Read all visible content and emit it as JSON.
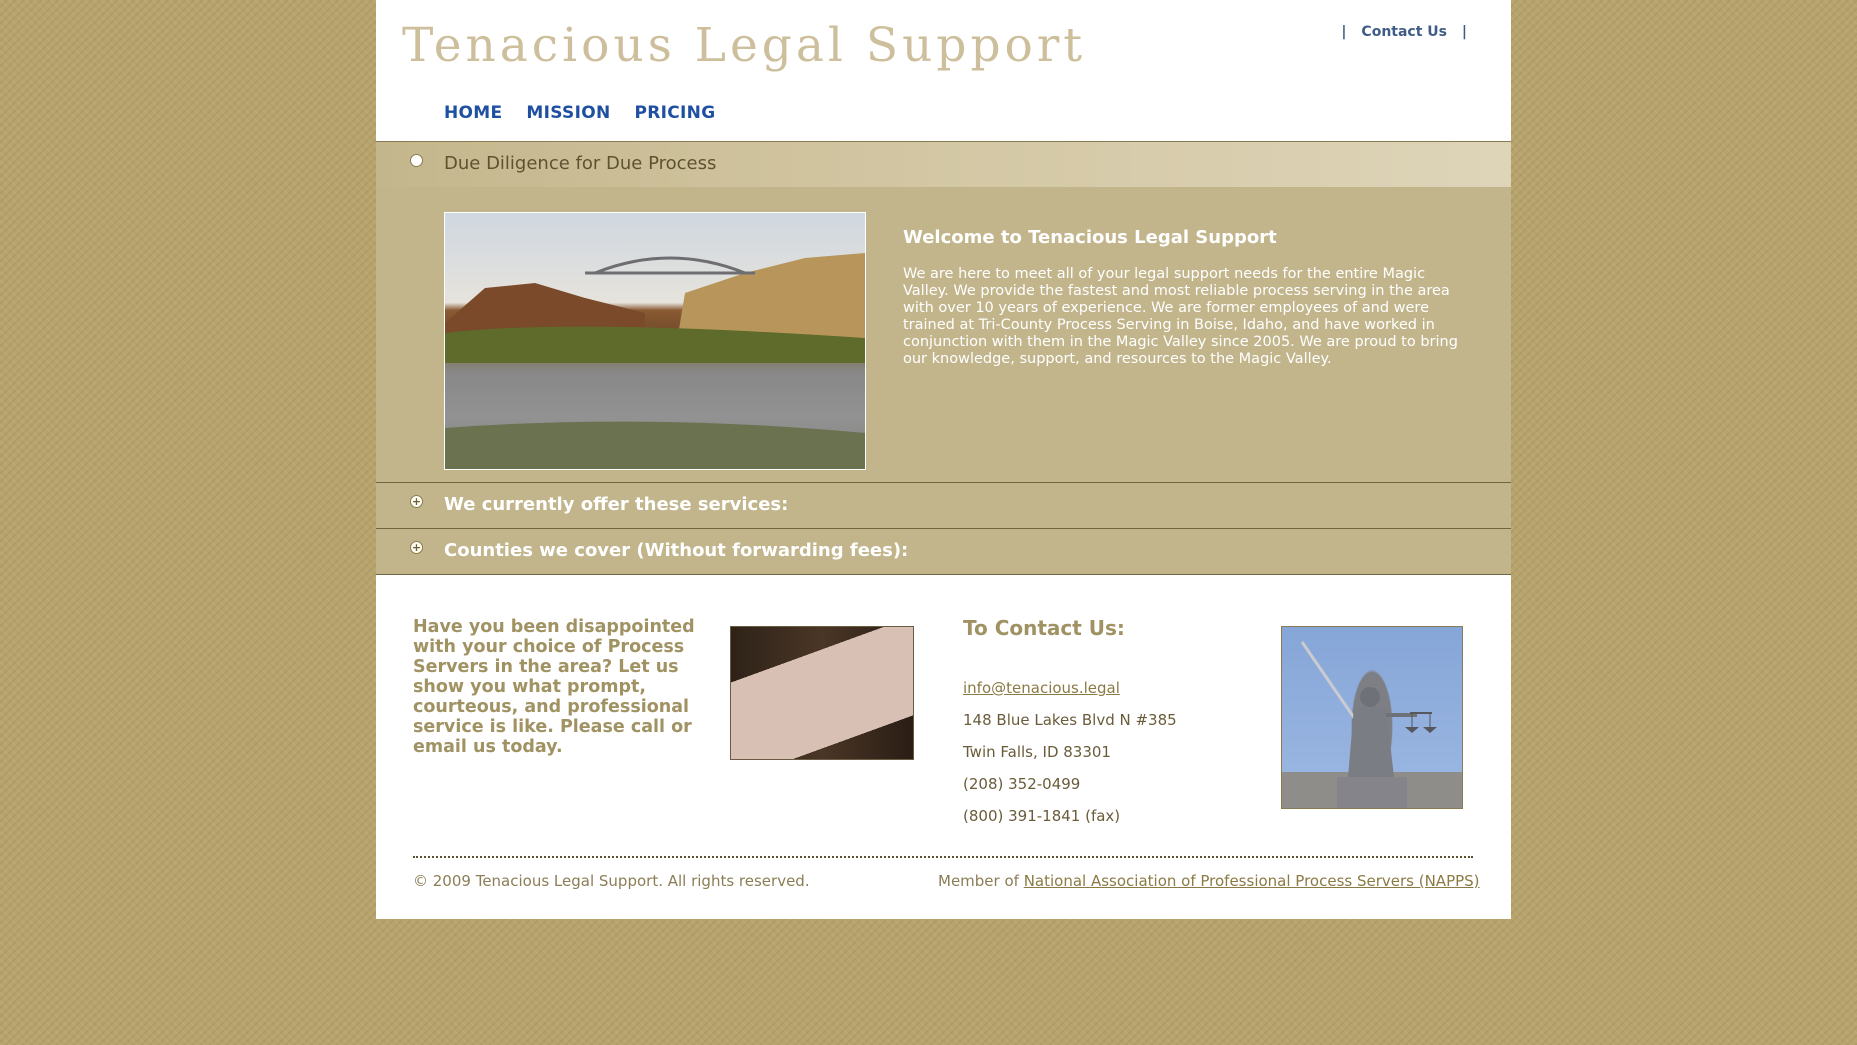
{
  "header": {
    "logo": "Tenacious Legal Support",
    "contact_link": "Contact Us",
    "separator": "|"
  },
  "nav": [
    "HOME",
    "MISSION",
    "PRICING"
  ],
  "banner": {
    "title": "Due Diligence for Due Process"
  },
  "welcome": {
    "title": "Welcome to Tenacious Legal Support",
    "text": "We are here to meet all of your legal support needs for the entire Magic Valley. We provide the fastest and most reliable process serving in the area with over 10 years of experience. We are former employees of and were trained at Tri-County Process Serving in Boise, Idaho, and have worked in conjunction with them in the Magic Valley since 2005. We are proud to bring our knowledge, support, and resources to the Magic Valley."
  },
  "accordion": [
    {
      "label": "We currently offer these services:"
    },
    {
      "label": "Counties we cover (Without forwarding fees):"
    }
  ],
  "promo": "Have you been disappointed with your choice of Process Servers in the area? Let us show you what prompt, courteous, and professional service is like.  Please call or email us today.",
  "contact": {
    "title": "To Contact Us:",
    "email": "info@tenacious.legal",
    "address1": "148 Blue Lakes Blvd N #385",
    "address2": "Twin Falls, ID 83301",
    "phone": "(208) 352-0499",
    "fax": "(800) 391-1841 (fax)"
  },
  "footer": {
    "copyright": "© 2009 Tenacious Legal Support. All rights reserved.",
    "member_prefix": "Member of ",
    "member_link": "National Association of Professional Process Servers (NAPPS)"
  }
}
